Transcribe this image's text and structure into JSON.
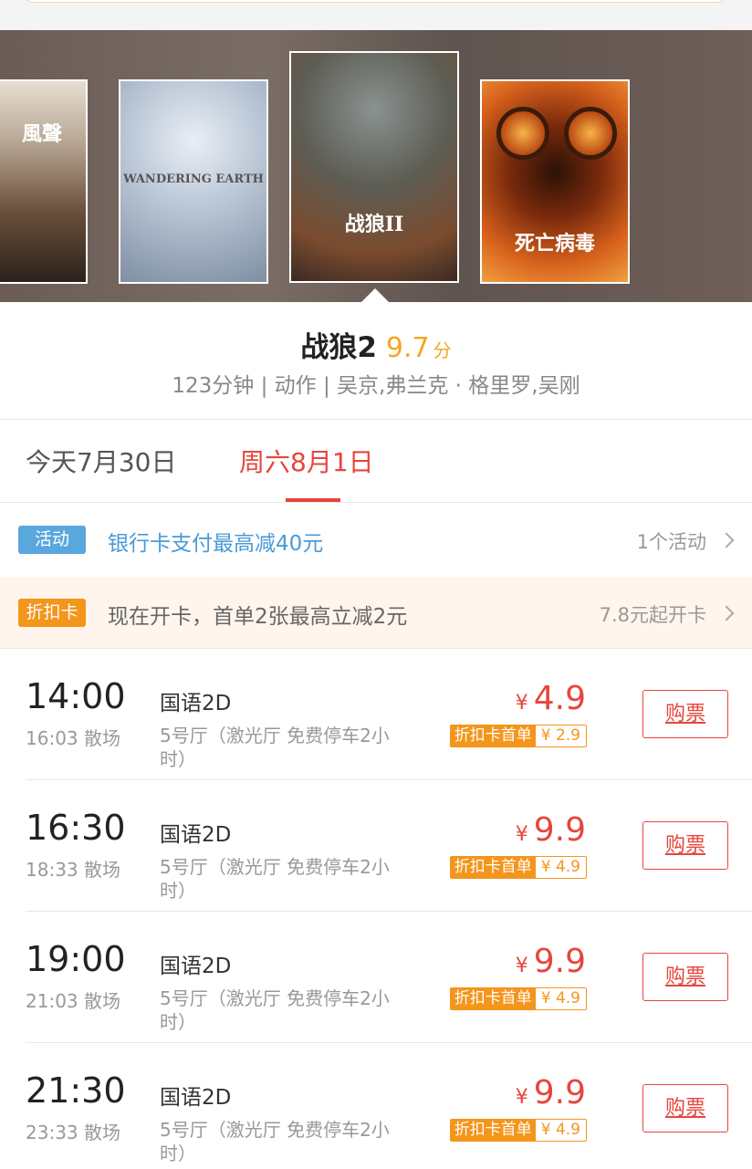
{
  "posters": [
    {
      "caption": "風聲"
    },
    {
      "caption": "WANDERING EARTH"
    },
    {
      "caption": "战狼II"
    },
    {
      "caption": "死亡病毒"
    }
  ],
  "movie": {
    "title": "战狼2",
    "score": "9.7",
    "score_unit": "分",
    "meta": "123分钟 | 动作 | 吴京,弗兰克 · 格里罗,吴刚"
  },
  "date_tabs": [
    {
      "label": "今天7月30日"
    },
    {
      "label": "周六8月1日"
    }
  ],
  "promo": {
    "tag": "活动",
    "text": "银行卡支付最高减40元",
    "right": "1个活动"
  },
  "discount_card": {
    "tag": "折扣卡",
    "text": "现在开卡，首单2张最高立减2元",
    "right": "7.8元起开卡"
  },
  "showtimes": [
    {
      "start": "14:00",
      "end": "16:03 散场",
      "lang": "国语2D",
      "hall": "5号厅（激光厅 免费停车2小时）",
      "currency": "¥",
      "price": "4.9",
      "disc_label": "折扣卡首单",
      "disc_price": "¥ 2.9",
      "buy": "购票"
    },
    {
      "start": "16:30",
      "end": "18:33 散场",
      "lang": "国语2D",
      "hall": "5号厅（激光厅 免费停车2小时）",
      "currency": "¥",
      "price": "9.9",
      "disc_label": "折扣卡首单",
      "disc_price": "¥ 4.9",
      "buy": "购票"
    },
    {
      "start": "19:00",
      "end": "21:03 散场",
      "lang": "国语2D",
      "hall": "5号厅（激光厅 免费停车2小时）",
      "currency": "¥",
      "price": "9.9",
      "disc_label": "折扣卡首单",
      "disc_price": "¥ 4.9",
      "buy": "购票"
    },
    {
      "start": "21:30",
      "end": "23:33 散场",
      "lang": "国语2D",
      "hall": "5号厅（激光厅 免费停车2小时）",
      "currency": "¥",
      "price": "9.9",
      "disc_label": "折扣卡首单",
      "disc_price": "¥ 4.9",
      "buy": "购票"
    }
  ]
}
